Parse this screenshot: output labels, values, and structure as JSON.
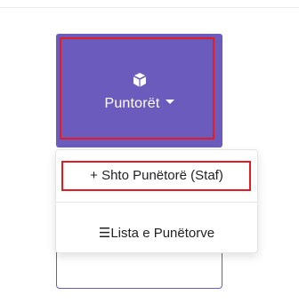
{
  "menu": {
    "button_label": "Puntorët",
    "icon": "cube-icon",
    "accent_color": "#6b5bbd",
    "highlight_color": "#e31b23"
  },
  "dropdown": {
    "items": [
      {
        "label": "+ Shto Punëtorë (Staf)",
        "icon": "plus"
      },
      {
        "label": "☰Lista e Punëtorve",
        "icon": "list-icon"
      }
    ]
  }
}
